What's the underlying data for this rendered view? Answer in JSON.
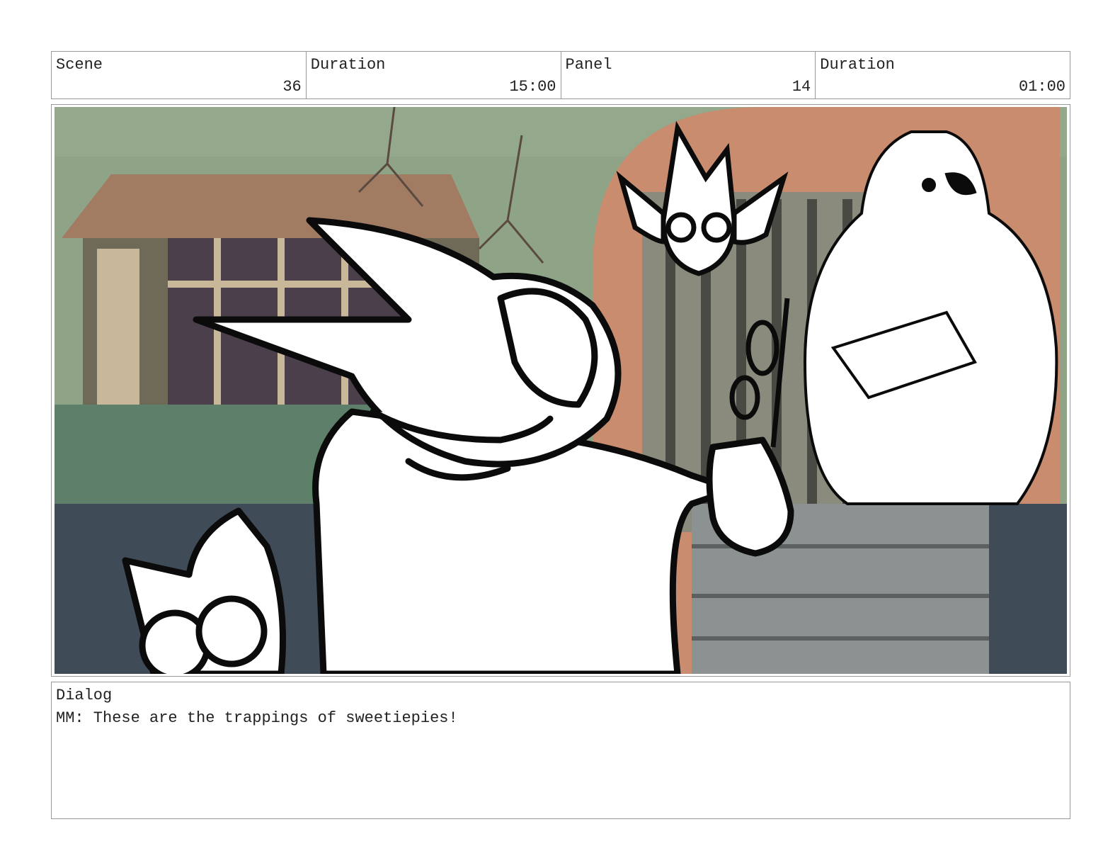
{
  "header": {
    "scene_label": "Scene",
    "scene_value": "36",
    "scene_duration_label": "Duration",
    "scene_duration_value": "15:00",
    "panel_label": "Panel",
    "panel_value": "14",
    "panel_duration_label": "Duration",
    "panel_duration_value": "01:00"
  },
  "dialog": {
    "label": "Dialog",
    "text": "MM: These are the trappings of sweetiepies!"
  },
  "colors": {
    "border": "#999999",
    "sky_green": "#8fa486",
    "roof": "#a27b63",
    "arch": "#c98c6f",
    "steps": "#8c9292",
    "ink": "#0b0b0b"
  }
}
